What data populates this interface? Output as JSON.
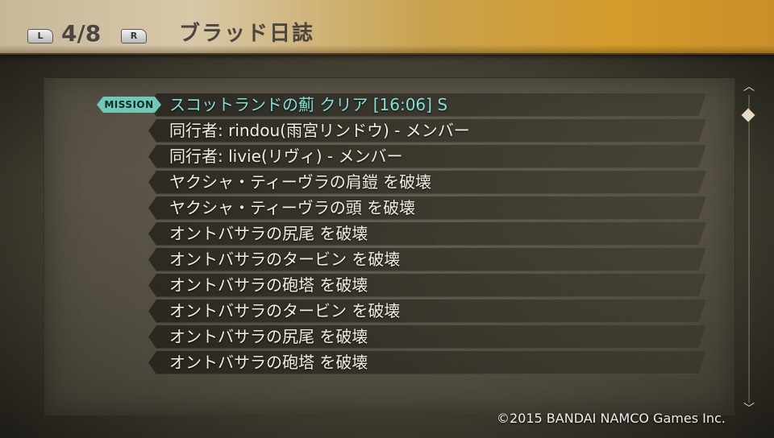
{
  "header": {
    "left_button": "L",
    "right_button": "R",
    "page_counter": "4/8",
    "title": "ブラッド日誌"
  },
  "log": {
    "badge": "MISSION",
    "entries": [
      "スコットランドの薊 クリア [16:06] S",
      "同行者: rindou(雨宮リンドウ) - メンバー",
      "同行者: livie(リヴィ) - メンバー",
      "ヤクシャ・ティーヴラの肩鎧 を破壊",
      "ヤクシャ・ティーヴラの頭 を破壊",
      "オントバサラの尻尾 を破壊",
      "オントバサラのタービン を破壊",
      "オントバサラの砲塔 を破壊",
      "オントバサラのタービン を破壊",
      "オントバサラの尻尾 を破壊",
      "オントバサラの砲塔 を破壊"
    ]
  },
  "scrollbar": {
    "up_icon": "chevron-up-icon",
    "down_icon": "chevron-down-icon",
    "position": 0.05
  },
  "footer": {
    "copyright": "©2015 BANDAI NAMCO Games Inc."
  },
  "colors": {
    "mission_text": "#7fe3d8",
    "mission_badge": "#6fc9b8",
    "entry_text": "#f2efe8",
    "header_gold": "#d49a2a"
  }
}
